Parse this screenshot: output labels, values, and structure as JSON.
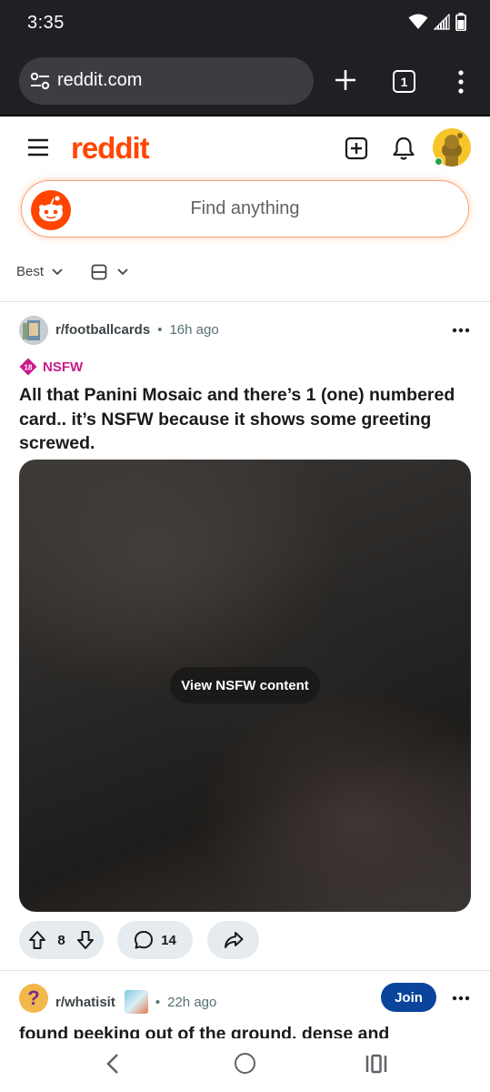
{
  "status_bar": {
    "time": "3:35"
  },
  "browser": {
    "url": "reddit.com",
    "tab_count": "1"
  },
  "header": {
    "logo_text": "reddit",
    "brand_color": "#ff4500"
  },
  "search": {
    "placeholder": "Find anything"
  },
  "sort": {
    "label": "Best"
  },
  "post1": {
    "subreddit": "r/footballcards",
    "time_ago": "16h ago",
    "nsfw_badge_num": "18",
    "nsfw_label": "NSFW",
    "title": "All that Panini Mosaic and there’s 1 (one) numbered card.. it’s NSFW because it shows some greeting screwed.",
    "view_nsfw_label": "View NSFW content",
    "vote_count": "8",
    "comment_count": "14"
  },
  "post2": {
    "subreddit": "r/whatisit",
    "avatar_glyph": "?",
    "time_ago": "22h ago",
    "join_label": "Join",
    "title_partial": "found peeking out of the ground, dense and"
  },
  "colors": {
    "status_bar_bg": "#1f2023",
    "nsfw_pink": "#c81b8a",
    "join_blue": "#0a449b",
    "pill_bg": "#e5ebee"
  }
}
